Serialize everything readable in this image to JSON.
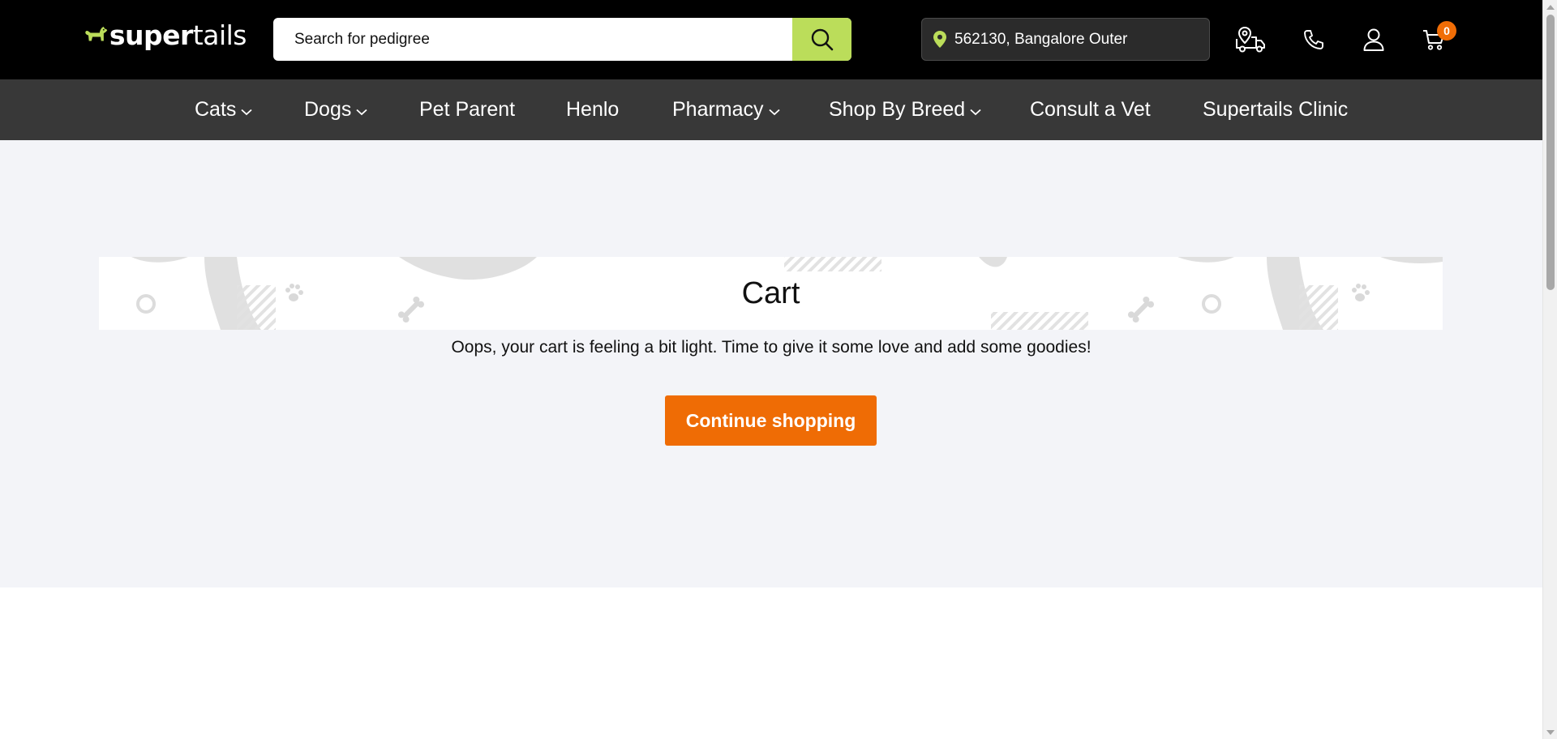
{
  "brand": {
    "logo_alt": "supertails",
    "logo_part1": "super",
    "logo_part2": "tails",
    "accent_color": "#bbdd5a"
  },
  "header": {
    "search": {
      "placeholder": "Search for pedigree",
      "value": "",
      "icon": "search-icon"
    },
    "location": {
      "text": "562130, Bangalore Outer",
      "icon": "map-pin-icon"
    },
    "icons": [
      "delivery-truck-icon",
      "phone-icon",
      "user-icon",
      "cart-icon"
    ],
    "cart_count": "0",
    "cart_badge_color": "#f06d06"
  },
  "nav": {
    "items": [
      {
        "label": "Cats",
        "dropdown": true
      },
      {
        "label": "Dogs",
        "dropdown": true
      },
      {
        "label": "Pet Parent",
        "dropdown": false
      },
      {
        "label": "Henlo",
        "dropdown": false
      },
      {
        "label": "Pharmacy",
        "dropdown": true
      },
      {
        "label": "Shop By Breed",
        "dropdown": true
      },
      {
        "label": "Consult a Vet",
        "dropdown": false
      },
      {
        "label": "Supertails Clinic",
        "dropdown": false
      }
    ]
  },
  "cart": {
    "title": "Cart",
    "empty_message": "Oops, your cart is feeling a bit light. Time to give it some love and add some goodies!",
    "continue_label": "Continue shopping",
    "button_color": "#ef6c05"
  }
}
